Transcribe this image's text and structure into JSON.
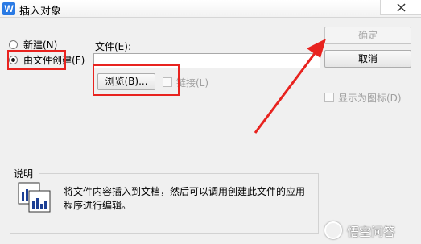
{
  "window": {
    "title": "插入对象",
    "app_icon_letter": "W",
    "close_glyph": "×"
  },
  "options": {
    "new_label": "新建(N)",
    "from_file_label": "由文件创建(F)",
    "selected": "from_file"
  },
  "file": {
    "label": "文件(E):",
    "value": ""
  },
  "browse_button": "浏览(B)...",
  "link_checkbox": {
    "label": "链接(L)",
    "checked": false,
    "enabled": false
  },
  "buttons": {
    "ok": "确定",
    "cancel": "取消"
  },
  "display_icon_checkbox": {
    "label": "显示为图标(D)",
    "checked": false,
    "enabled": false
  },
  "description": {
    "heading": "说明",
    "line1": "将文件内容插入到文档，然后可以调用创建此文件的应用",
    "line2": "程序进行编辑。"
  },
  "watermark": {
    "text": "悟空问答"
  },
  "colors": {
    "annotation_red": "#e8231f",
    "disabled_text": "#a8a8a8",
    "dialog_bg": "#f0f0f0"
  }
}
